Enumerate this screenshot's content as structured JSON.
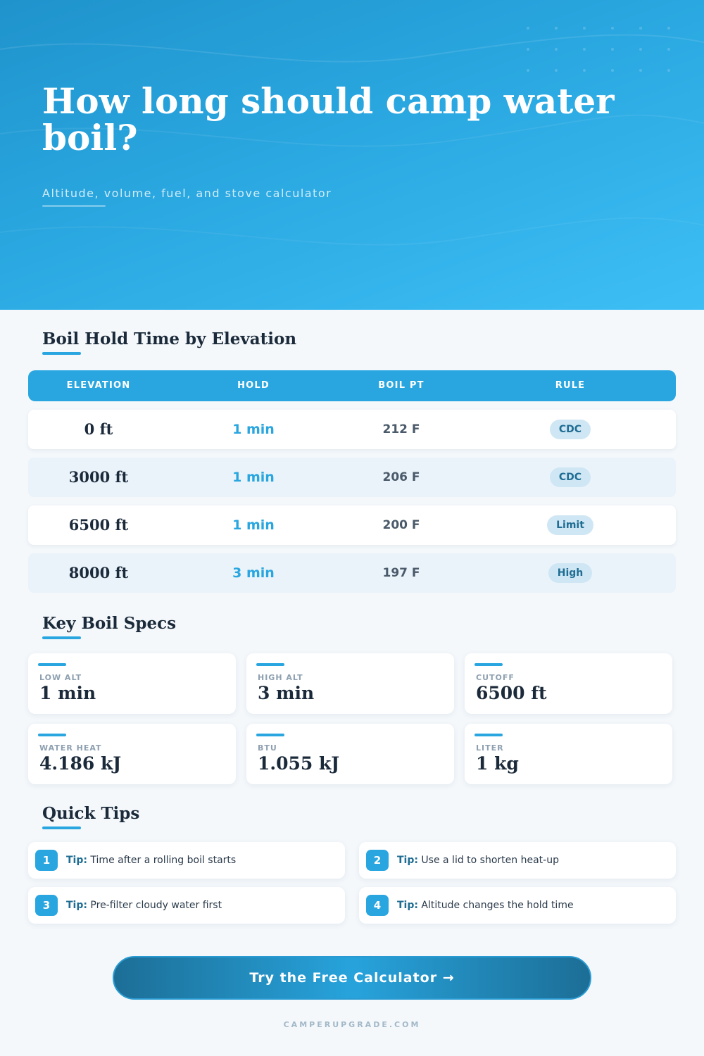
{
  "hero": {
    "title": "How long should camp water boil?",
    "subtitle": "Altitude, volume, fuel, and stove calculator"
  },
  "table_section": {
    "title": "Boil Hold Time by Elevation",
    "headers": [
      "ELEVATION",
      "HOLD",
      "BOIL PT",
      "RULE"
    ],
    "rows": [
      {
        "elevation": "0 ft",
        "hold": "1 min",
        "boil_pt": "212 F",
        "rule": "CDC"
      },
      {
        "elevation": "3000 ft",
        "hold": "1 min",
        "boil_pt": "206 F",
        "rule": "CDC"
      },
      {
        "elevation": "6500 ft",
        "hold": "1 min",
        "boil_pt": "200 F",
        "rule": "Limit"
      },
      {
        "elevation": "8000 ft",
        "hold": "3 min",
        "boil_pt": "197 F",
        "rule": "High"
      }
    ]
  },
  "specs_section": {
    "title": "Key Boil Specs",
    "cards": [
      {
        "label": "LOW ALT",
        "value": "1 min"
      },
      {
        "label": "HIGH ALT",
        "value": "3 min"
      },
      {
        "label": "CUTOFF",
        "value": "6500 ft"
      },
      {
        "label": "WATER HEAT",
        "value": "4.186 kJ"
      },
      {
        "label": "BTU",
        "value": "1.055 kJ"
      },
      {
        "label": "LITER",
        "value": "1 kg"
      }
    ]
  },
  "tips_section": {
    "title": "Quick Tips",
    "prefix": "Tip:",
    "items": [
      {
        "num": "1",
        "text": "Time after a rolling boil starts"
      },
      {
        "num": "2",
        "text": "Use a lid to shorten heat-up"
      },
      {
        "num": "3",
        "text": "Pre-filter cloudy water first"
      },
      {
        "num": "4",
        "text": "Altitude changes the hold time"
      }
    ]
  },
  "cta": {
    "label": "Try the Free Calculator →"
  },
  "footer": {
    "text": "CAMPERUPGRADE.COM"
  },
  "colors": {
    "accent": "#29a6e0",
    "hero_top": "#1f93cc",
    "hero_bottom": "#3dbff5",
    "badge_bg": "#cfe6f4",
    "badge_text": "#1f6d93"
  }
}
